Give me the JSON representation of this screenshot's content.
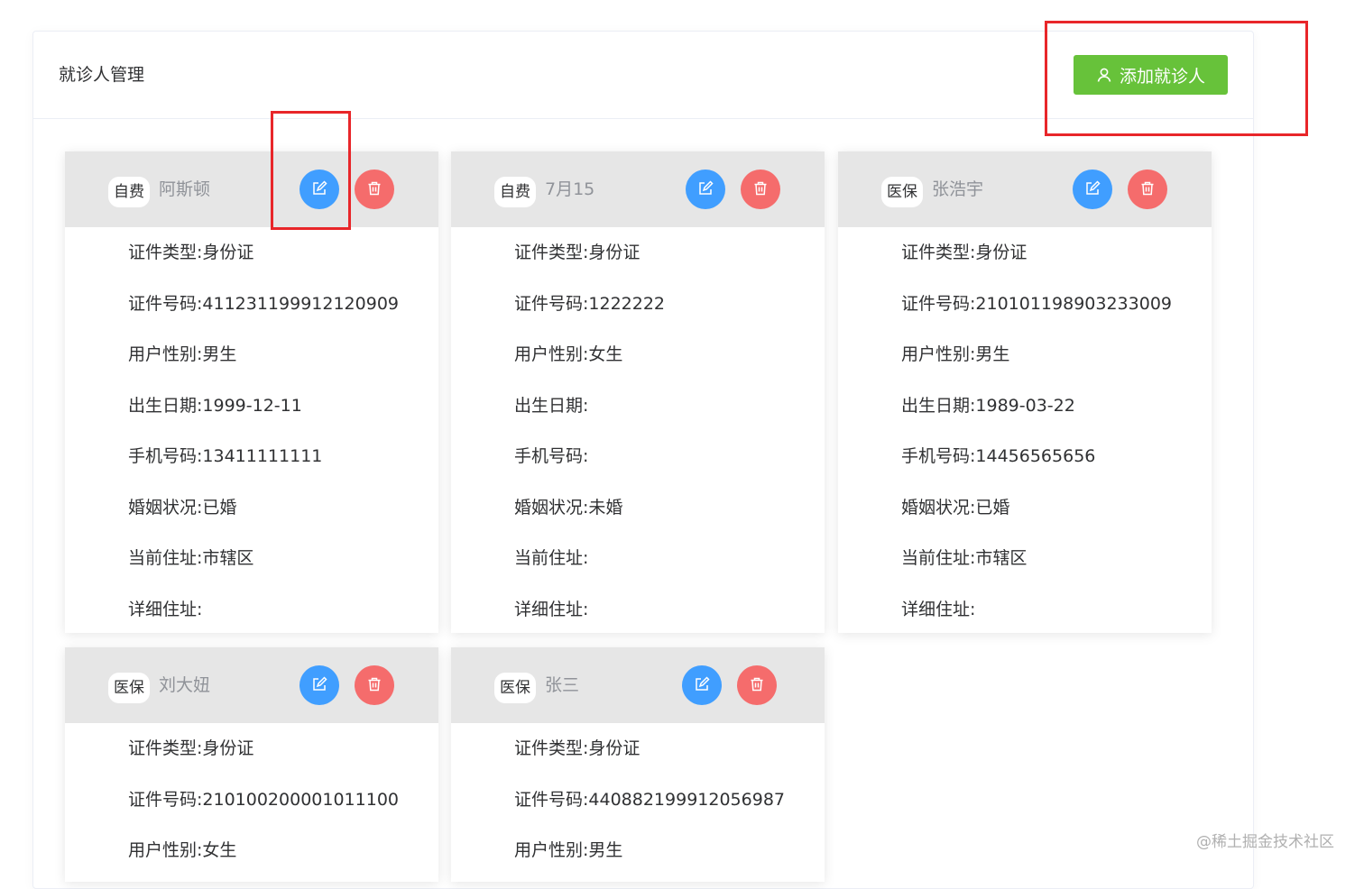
{
  "page": {
    "title": "就诊人管理",
    "add_button_label": "添加就诊人",
    "watermark": "@稀土掘金技术社区"
  },
  "labels": {
    "id_type": "证件类型:",
    "id_number": "证件号码:",
    "gender": "用户性别:",
    "birth_date": "出生日期:",
    "phone": "手机号码:",
    "marital_status": "婚姻状况:",
    "current_address": "当前住址:",
    "detail_address": "详细住址:"
  },
  "icons": {
    "add": "user-icon",
    "edit": "edit-icon",
    "delete": "trash-icon"
  },
  "colors": {
    "add_button": "#67c23a",
    "edit_button": "#409eff",
    "delete_button": "#f56c6c",
    "highlight": "#e8262a"
  },
  "patients": [
    {
      "insurance": "自费",
      "name": "阿斯顿",
      "id_type": "证件类型:身份证",
      "id_number": "证件号码:411231199912120909",
      "gender": "用户性别:男生",
      "birth_date": "出生日期:1999-12-11",
      "phone": "手机号码:13411111111",
      "marital_status": "婚姻状况:已婚",
      "current_address": "当前住址:市辖区",
      "detail_address": "详细住址:"
    },
    {
      "insurance": "自费",
      "name": "7月15",
      "id_type": "证件类型:身份证",
      "id_number": "证件号码:1222222",
      "gender": "用户性别:女生",
      "birth_date": "出生日期:",
      "phone": "手机号码:",
      "marital_status": "婚姻状况:未婚",
      "current_address": "当前住址:",
      "detail_address": "详细住址:"
    },
    {
      "insurance": "医保",
      "name": "张浩宇",
      "id_type": "证件类型:身份证",
      "id_number": "证件号码:210101198903233009",
      "gender": "用户性别:男生",
      "birth_date": "出生日期:1989-03-22",
      "phone": "手机号码:14456565656",
      "marital_status": "婚姻状况:已婚",
      "current_address": "当前住址:市辖区",
      "detail_address": "详细住址:"
    },
    {
      "insurance": "医保",
      "name": "刘大妞",
      "id_type": "证件类型:身份证",
      "id_number": "证件号码:210100200001011100",
      "gender": "用户性别:女生"
    },
    {
      "insurance": "医保",
      "name": "张三",
      "id_type": "证件类型:身份证",
      "id_number": "证件号码:440882199912056987",
      "gender": "用户性别:男生"
    }
  ]
}
